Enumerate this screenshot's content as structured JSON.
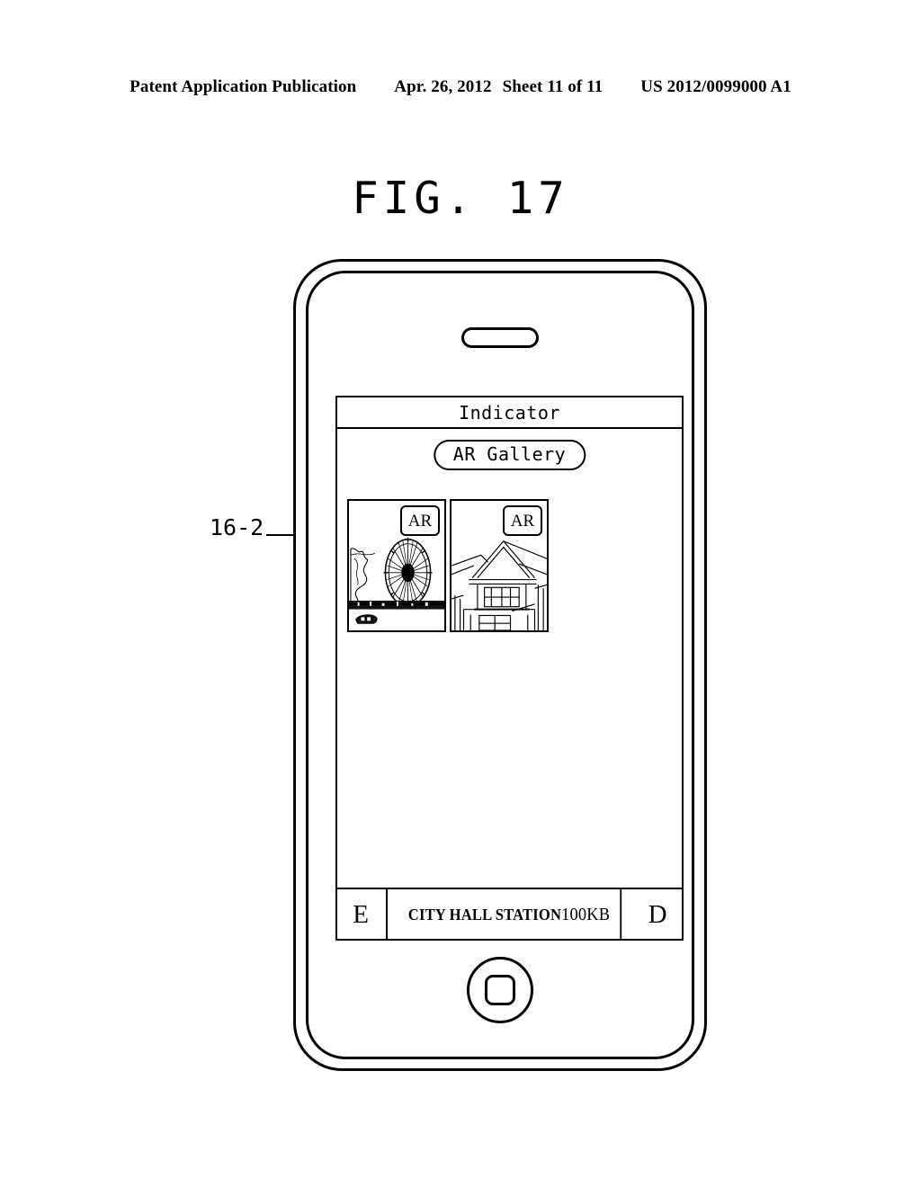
{
  "header": {
    "publication": "Patent Application Publication",
    "date": "Apr. 26, 2012",
    "sheet": "Sheet 11 of 11",
    "patent_number": "US 2012/0099000 A1"
  },
  "figure": {
    "title": "FIG. 17",
    "reference_label": "16-2"
  },
  "device": {
    "screen": {
      "indicator": "Indicator",
      "gallery_button": "AR Gallery",
      "thumbnails": [
        {
          "badge": "AR",
          "subject": "ferris-wheel-photo"
        },
        {
          "badge": "AR",
          "subject": "house-photo"
        }
      ],
      "bottom_bar": {
        "left_button": "E",
        "station_name": "CITY HALL STATION",
        "data_size": "100KB",
        "right_button": "D"
      }
    }
  },
  "colors": {
    "ink": "#000000",
    "paper": "#ffffff"
  }
}
